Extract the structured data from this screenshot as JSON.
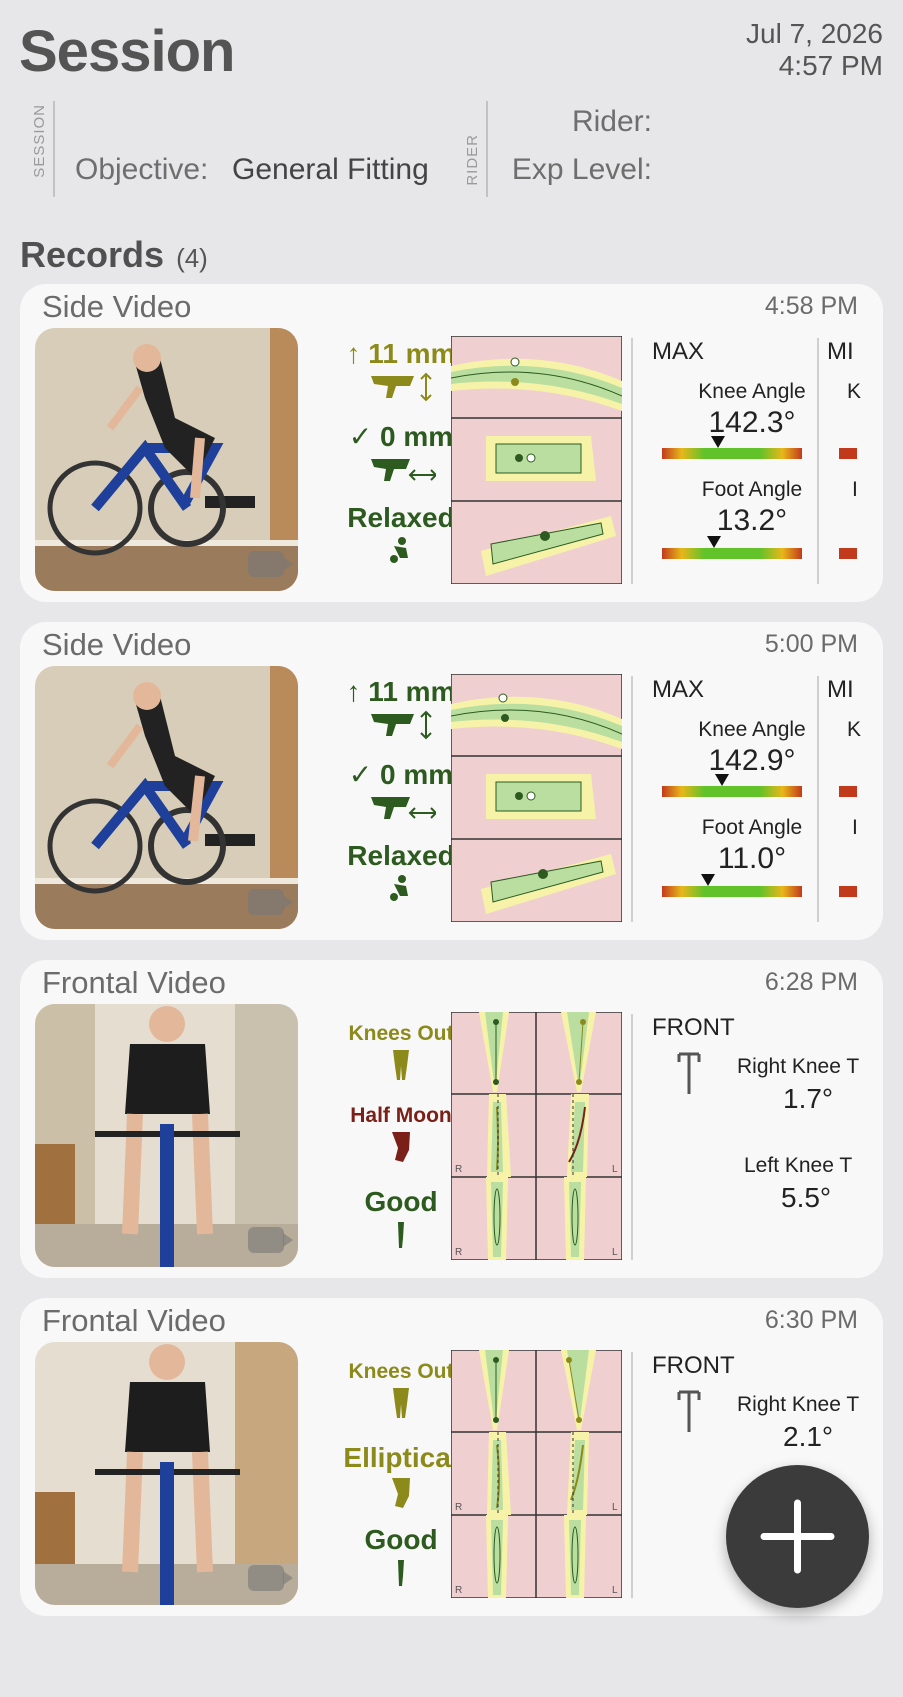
{
  "header": {
    "title": "Session",
    "date": "Jul 7, 2026",
    "time": "4:57 PM",
    "session_label": "SESSION",
    "rider_label": "RIDER",
    "objective_label": "Objective:",
    "objective_value": "General Fitting",
    "rider_field_label": "Rider:",
    "exp_level_label": "Exp Level:"
  },
  "records": {
    "title": "Records",
    "count": "(4)"
  },
  "cards": [
    {
      "title": "Side Video",
      "time": "4:58 PM",
      "ind1": "↑ 11 mm",
      "ind2": "✓ 0 mm",
      "ind3": "Relaxed",
      "head1": "MAX",
      "head2": "MI",
      "m1_label": "Knee Angle",
      "m1_value": "142.3°",
      "m1_pos": 0.4,
      "m2_label": "Foot Angle",
      "m2_value": "13.2°",
      "m2_pos": 0.37,
      "stub1": "K",
      "stub2": "I"
    },
    {
      "title": "Side Video",
      "time": "5:00 PM",
      "ind1": "↑ 11 mm",
      "ind2": "✓ 0 mm",
      "ind3": "Relaxed",
      "head1": "MAX",
      "head2": "MI",
      "m1_label": "Knee Angle",
      "m1_value": "142.9°",
      "m1_pos": 0.43,
      "m2_label": "Foot Angle",
      "m2_value": "11.0°",
      "m2_pos": 0.33,
      "stub1": "K",
      "stub2": "I"
    },
    {
      "title": "Frontal Video",
      "time": "6:28 PM",
      "ind1": "Knees Out",
      "ind2": "Half Moon",
      "ind3": "Good",
      "head1": "FRONT",
      "f1_label": "Right Knee T",
      "f1_value": "1.7°",
      "f2_label": "Left Knee T",
      "f2_value": "5.5°"
    },
    {
      "title": "Frontal Video",
      "time": "6:30 PM",
      "ind1": "Knees Out",
      "ind2": "Elliptical",
      "ind3": "Good",
      "head1": "FRONT",
      "f1_label": "Right Knee T",
      "f1_value": "2.1°"
    }
  ],
  "chart_labels": {
    "r": "R",
    "l": "L"
  },
  "colors": {
    "olive": "#8c8a1a",
    "dark_green": "#2d5a1e",
    "half_moon_red": "#7a2018",
    "chart_pink": "#f0cfd1",
    "chart_yellow": "#f6f3a8",
    "chart_green": "#b9dea0"
  }
}
